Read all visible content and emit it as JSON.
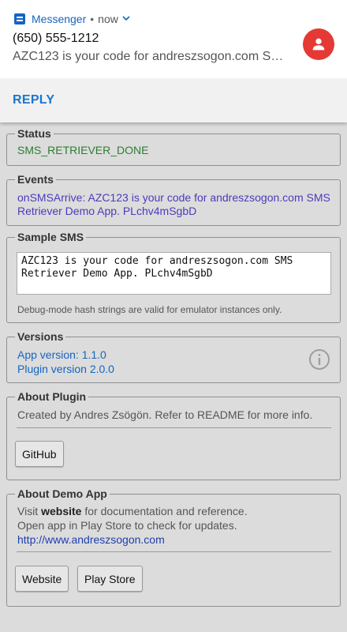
{
  "notification": {
    "app_name": "Messenger",
    "separator": "•",
    "time": "now",
    "sender": "(650) 555-1212",
    "preview": "AZC123 is your code for andreszsogon.com SMS Retriever Demo App. PLchv4mSgbD",
    "reply_label": "REPLY",
    "avatar_color": "#e53935",
    "accent_color": "#1565c0"
  },
  "status": {
    "legend": "Status",
    "value": "SMS_RETRIEVER_DONE",
    "color": "#2e7d32"
  },
  "events": {
    "legend": "Events",
    "lines": [
      "onSMSArrive: AZC123 is your code for andreszsogon.com SMS",
      "Retriever Demo App. PLchv4mSgbD"
    ]
  },
  "sample_sms": {
    "legend": "Sample SMS",
    "value": "AZC123 is your code for andreszsogon.com SMS\nRetriever Demo App. PLchv4mSgbD",
    "hint": "Debug-mode hash strings are valid for emulator instances only."
  },
  "versions": {
    "legend": "Versions",
    "app_version": "App version: 1.1.0",
    "plugin_version": "Plugin version 2.0.0"
  },
  "about_plugin": {
    "legend": "About Plugin",
    "text": "Created by Andres Zsögön. Refer to README for more info.",
    "github_button": "GitHub"
  },
  "about_demo": {
    "legend": "About Demo App",
    "visit_prefix": "Visit ",
    "visit_link": "website",
    "visit_suffix": " for documentation and reference.",
    "play_line": "Open app in Play Store to check for updates.",
    "url": "http://www.andreszsogon.com",
    "website_button": "Website",
    "playstore_button": "Play Store"
  }
}
